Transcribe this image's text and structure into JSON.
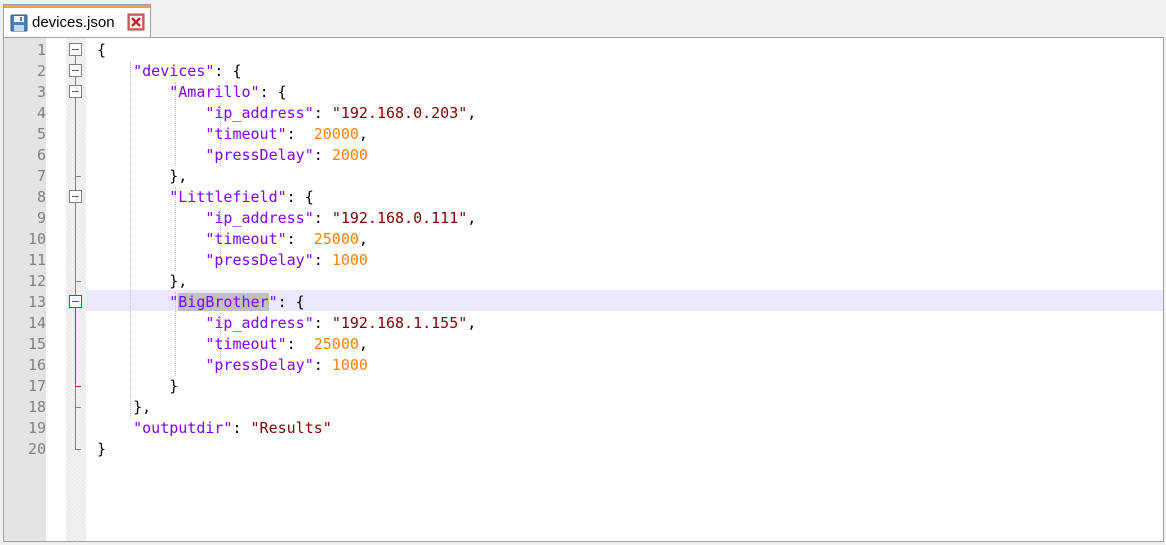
{
  "tab": {
    "title": "devices.json"
  },
  "line_numbers": [
    "1",
    "2",
    "3",
    "4",
    "5",
    "6",
    "7",
    "8",
    "9",
    "10",
    "11",
    "12",
    "13",
    "14",
    "15",
    "16",
    "17",
    "18",
    "19",
    "20"
  ],
  "code": {
    "line1": "{",
    "line2": {
      "key": "\"devices\"",
      "rest": ": {"
    },
    "devices": [
      {
        "key": "\"Amarillo\"",
        "ip_key": "\"ip_address\"",
        "ip": "\"192.168.0.203\"",
        "timeout_key": "\"timeout\"",
        "timeout": "20000",
        "delay_key": "\"pressDelay\"",
        "delay": "2000",
        "close": "},"
      },
      {
        "key": "\"Littlefield\"",
        "ip_key": "\"ip_address\"",
        "ip": "\"192.168.0.111\"",
        "timeout_key": "\"timeout\"",
        "timeout": "25000",
        "delay_key": "\"pressDelay\"",
        "delay": "1000",
        "close": "},"
      },
      {
        "key_open_quote": "\"",
        "key_highlight": "BigBrother",
        "key_close_quote": "\"",
        "ip_key": "\"ip_address\"",
        "ip": "\"192.168.1.155\"",
        "timeout_key": "\"timeout\"",
        "timeout": "25000",
        "delay_key": "\"pressDelay\"",
        "delay": "1000",
        "close": "}"
      }
    ],
    "line18": "},",
    "line19": {
      "key": "\"outputdir\"",
      "value": "\"Results\""
    },
    "line20": "}"
  },
  "colors": {
    "key": "#8000ff",
    "string": "#800000",
    "number": "#ff8000",
    "current_line": "#e8e8ff",
    "tab_accent": "#f7a23c"
  }
}
